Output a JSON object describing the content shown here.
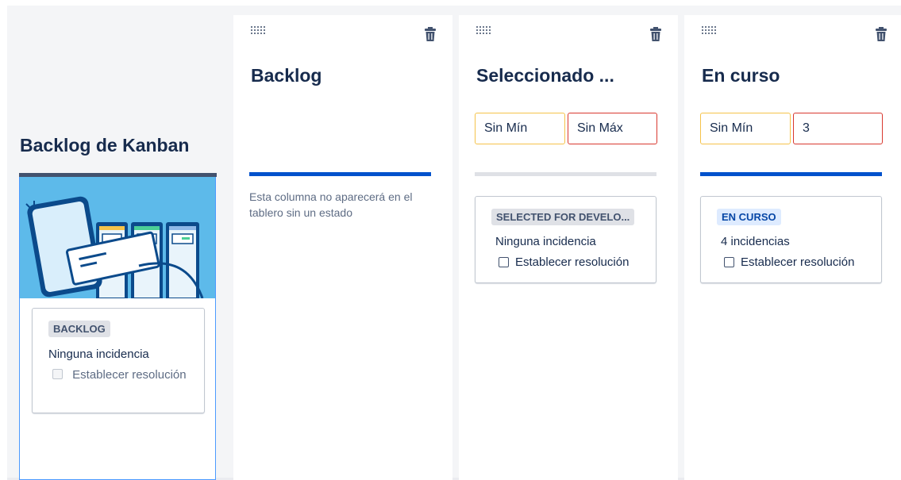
{
  "backlog": {
    "title": "Backlog de Kanban",
    "card": {
      "status": "BACKLOG",
      "issues": "Ninguna incidencia",
      "resolution_label": "Establecer resolución",
      "resolution_checked": false,
      "resolution_disabled": true
    }
  },
  "columns": [
    {
      "title": "Backlog",
      "bar_color": "#0052cc",
      "note": "Esta columna no aparecerá en el tablero sin un estado"
    },
    {
      "title": "Seleccionado ...",
      "bar_color": "#dfe1e6",
      "min_placeholder": "Sin Mín",
      "max_placeholder": "Sin Máx",
      "min_value": "",
      "max_value": "",
      "card": {
        "status": "SELECTED FOR DEVELO...",
        "status_color": "grey",
        "issues": "Ninguna incidencia",
        "resolution_label": "Establecer resolución",
        "resolution_checked": false
      }
    },
    {
      "title": "En curso",
      "bar_color": "#0052cc",
      "min_placeholder": "Sin Mín",
      "max_placeholder": "Sin Máx",
      "min_value": "",
      "max_value": "3",
      "card": {
        "status": "EN CURSO",
        "status_color": "blue",
        "issues": "4 incidencias",
        "resolution_label": "Establecer resolución",
        "resolution_checked": false
      }
    }
  ],
  "icons": {
    "drag": "drag-handle-icon",
    "delete": "trash-icon"
  },
  "colors": {
    "accent": "#0052cc",
    "min_border": "#f5c34a",
    "max_border": "#d9382f",
    "canvas": "#f4f5f7"
  }
}
